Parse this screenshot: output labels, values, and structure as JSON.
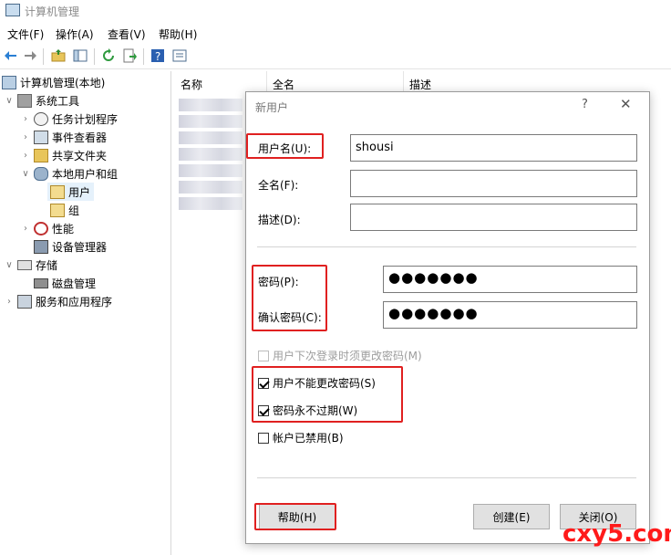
{
  "window": {
    "title": "计算机管理"
  },
  "menu": [
    "文件(F)",
    "操作(A)",
    "查看(V)",
    "帮助(H)"
  ],
  "tree": {
    "root": "计算机管理(本地)",
    "system_tools": "系统工具",
    "task_scheduler": "任务计划程序",
    "event_viewer": "事件查看器",
    "shared_folders": "共享文件夹",
    "local_users_groups": "本地用户和组",
    "users": "用户",
    "groups": "组",
    "performance": "性能",
    "device_manager": "设备管理器",
    "storage": "存储",
    "disk_management": "磁盘管理",
    "services_apps": "服务和应用程序"
  },
  "list": {
    "columns": [
      "名称",
      "全名",
      "描述"
    ]
  },
  "dialog": {
    "title": "新用户",
    "help_glyph": "?",
    "close_glyph": "✕",
    "username_label": "用户名(U):",
    "username_value": "shousi",
    "fullname_label": "全名(F):",
    "fullname_value": "",
    "description_label": "描述(D):",
    "description_value": "",
    "password_label": "密码(P):",
    "password_value": "●●●●●●●",
    "confirm_label": "确认密码(C):",
    "confirm_value": "●●●●●●●",
    "must_change_label": "用户下次登录时须更改密码(M)",
    "cannot_change_label": "用户不能更改密码(S)",
    "never_expires_label": "密码永不过期(W)",
    "disabled_label": "帐户已禁用(B)",
    "help_button": "帮助(H)",
    "create_button": "创建(E)",
    "close_button": "关闭(O)",
    "checkboxes": {
      "must_change": false,
      "cannot_change": true,
      "never_expires": true,
      "disabled": false
    }
  },
  "watermark": "cxy5.com",
  "colors": {
    "highlight": "#e02020",
    "selection": "#e5f1fb",
    "watermark": "#ff1a1a"
  }
}
